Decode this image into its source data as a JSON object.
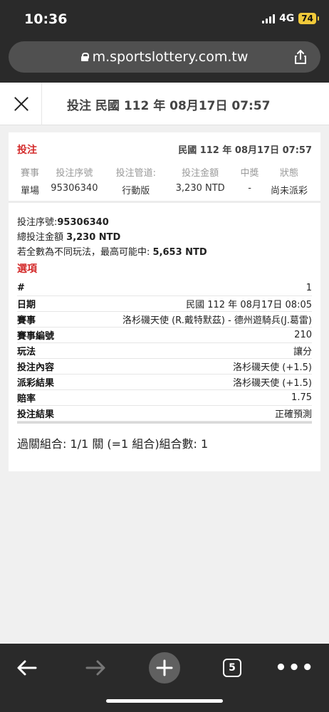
{
  "status_bar": {
    "time": "10:36",
    "network": "4G",
    "battery": "74"
  },
  "browser": {
    "url": "m.sportslottery.com.tw",
    "tab_count": "5"
  },
  "page_header": {
    "title": "投注 民國 112 年 08月17日 07:57"
  },
  "bet_summary": {
    "label": "投注",
    "date": "民國 112 年 08月17日 07:57",
    "headers": [
      "賽事",
      "投注序號",
      "投注管道:",
      "投注金額",
      "中獎",
      "狀態"
    ],
    "values": [
      "單場",
      "95306340",
      "行動版",
      "3,230 NTD",
      "-",
      "尚未派彩"
    ]
  },
  "details": {
    "serial_label": "投注序號:",
    "serial": "95306340",
    "total_label": "總投注金額",
    "total": "3,230 NTD",
    "max_label": "若全數為不同玩法，最高可能中:",
    "max": "5,653 NTD",
    "options_title": "選項"
  },
  "selection": [
    {
      "key": "#",
      "value": "1"
    },
    {
      "key": "日期",
      "value": "民國 112 年 08月17日 08:05"
    },
    {
      "key": "賽事",
      "value": "洛杉磯天使 (R.戴特默茲) - 德州遊騎兵(J.葛雷)"
    },
    {
      "key": "賽事編號",
      "value": "210"
    },
    {
      "key": "玩法",
      "value": "讓分"
    },
    {
      "key": "投注內容",
      "value": "洛杉磯天使 (+1.5)"
    },
    {
      "key": "派彩結果",
      "value": "洛杉磯天使 (+1.5)"
    },
    {
      "key": "賠率",
      "value": "1.75"
    },
    {
      "key": "投注結果",
      "value": "正確預測"
    }
  ],
  "combo_text": "過關組合: 1/1 關 (=1 組合)組合數: 1",
  "colors": {
    "accent_red": "#d32a2a",
    "chrome_dark": "#2a2a2a",
    "battery": "#f0c93a"
  },
  "icons": [
    "lock-icon",
    "share-icon",
    "close-icon",
    "back-arrow-icon",
    "forward-arrow-icon",
    "plus-icon",
    "tabs-icon",
    "more-icon"
  ]
}
